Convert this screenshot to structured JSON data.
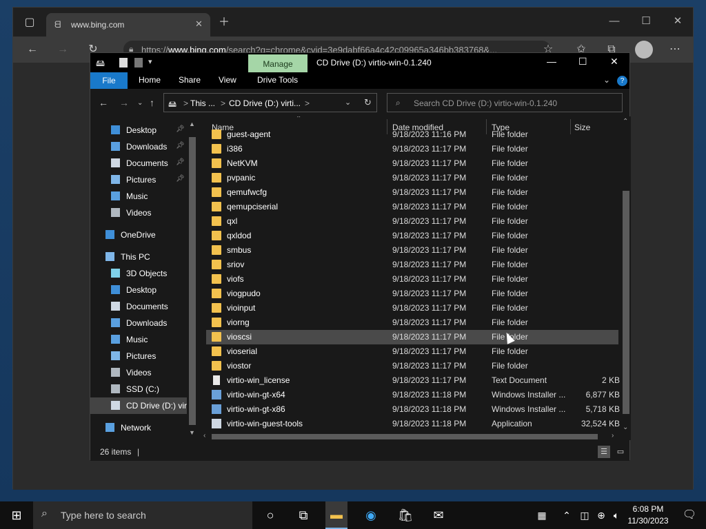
{
  "browser": {
    "tab_title": "www.bing.com",
    "url_prefix": "https://",
    "url_host": "www.bing.com",
    "url_rest": "/search?q=chrome&cvid=3e9dabf66a4c42c09965a346bb383768&..."
  },
  "explorer": {
    "context_tab": "Manage",
    "title": "CD Drive (D:) virtio-win-0.1.240",
    "ribbon": {
      "file": "File",
      "home": "Home",
      "share": "Share",
      "view": "View",
      "drive_tools": "Drive Tools"
    },
    "address": {
      "seg1": "This ...",
      "seg2": "CD Drive (D:) virti...",
      "sep": ">"
    },
    "search_placeholder": "Search CD Drive (D:) virtio-win-0.1.240",
    "columns": {
      "name": "Name",
      "date": "Date modified",
      "type": "Type",
      "size": "Size"
    },
    "sidebar": [
      {
        "label": "Desktop",
        "pinned": true,
        "icon": "desktop-icon"
      },
      {
        "label": "Downloads",
        "pinned": true,
        "icon": "downloads-icon"
      },
      {
        "label": "Documents",
        "pinned": true,
        "icon": "documents-icon"
      },
      {
        "label": "Pictures",
        "pinned": true,
        "icon": "pictures-icon"
      },
      {
        "label": "Music",
        "pinned": false,
        "icon": "music-icon"
      },
      {
        "label": "Videos",
        "pinned": false,
        "icon": "videos-icon"
      },
      {
        "label": "OneDrive",
        "pinned": false,
        "icon": "onedrive-icon"
      },
      {
        "label": "This PC",
        "pinned": false,
        "icon": "this-pc-icon"
      },
      {
        "label": "3D Objects",
        "pinned": false,
        "icon": "3d-objects-icon"
      },
      {
        "label": "Desktop",
        "pinned": false,
        "icon": "desktop-icon"
      },
      {
        "label": "Documents",
        "pinned": false,
        "icon": "documents-icon"
      },
      {
        "label": "Downloads",
        "pinned": false,
        "icon": "downloads-icon"
      },
      {
        "label": "Music",
        "pinned": false,
        "icon": "music-icon"
      },
      {
        "label": "Pictures",
        "pinned": false,
        "icon": "pictures-icon"
      },
      {
        "label": "Videos",
        "pinned": false,
        "icon": "videos-icon"
      },
      {
        "label": "SSD (C:)",
        "pinned": false,
        "icon": "drive-icon"
      },
      {
        "label": "CD Drive (D:) virt",
        "pinned": false,
        "icon": "cd-drive-icon"
      },
      {
        "label": "Network",
        "pinned": false,
        "icon": "network-icon"
      }
    ],
    "files": [
      {
        "name": "guest-agent",
        "date": "9/18/2023 11:16 PM",
        "type": "File folder",
        "size": "",
        "kind": "folder"
      },
      {
        "name": "i386",
        "date": "9/18/2023 11:17 PM",
        "type": "File folder",
        "size": "",
        "kind": "folder"
      },
      {
        "name": "NetKVM",
        "date": "9/18/2023 11:17 PM",
        "type": "File folder",
        "size": "",
        "kind": "folder"
      },
      {
        "name": "pvpanic",
        "date": "9/18/2023 11:17 PM",
        "type": "File folder",
        "size": "",
        "kind": "folder"
      },
      {
        "name": "qemufwcfg",
        "date": "9/18/2023 11:17 PM",
        "type": "File folder",
        "size": "",
        "kind": "folder"
      },
      {
        "name": "qemupciserial",
        "date": "9/18/2023 11:17 PM",
        "type": "File folder",
        "size": "",
        "kind": "folder"
      },
      {
        "name": "qxl",
        "date": "9/18/2023 11:17 PM",
        "type": "File folder",
        "size": "",
        "kind": "folder"
      },
      {
        "name": "qxldod",
        "date": "9/18/2023 11:17 PM",
        "type": "File folder",
        "size": "",
        "kind": "folder"
      },
      {
        "name": "smbus",
        "date": "9/18/2023 11:17 PM",
        "type": "File folder",
        "size": "",
        "kind": "folder"
      },
      {
        "name": "sriov",
        "date": "9/18/2023 11:17 PM",
        "type": "File folder",
        "size": "",
        "kind": "folder"
      },
      {
        "name": "viofs",
        "date": "9/18/2023 11:17 PM",
        "type": "File folder",
        "size": "",
        "kind": "folder"
      },
      {
        "name": "viogpudo",
        "date": "9/18/2023 11:17 PM",
        "type": "File folder",
        "size": "",
        "kind": "folder"
      },
      {
        "name": "vioinput",
        "date": "9/18/2023 11:17 PM",
        "type": "File folder",
        "size": "",
        "kind": "folder"
      },
      {
        "name": "viorng",
        "date": "9/18/2023 11:17 PM",
        "type": "File folder",
        "size": "",
        "kind": "folder"
      },
      {
        "name": "vioscsi",
        "date": "9/18/2023 11:17 PM",
        "type": "File folder",
        "size": "",
        "kind": "folder",
        "hover": true
      },
      {
        "name": "vioserial",
        "date": "9/18/2023 11:17 PM",
        "type": "File folder",
        "size": "",
        "kind": "folder"
      },
      {
        "name": "viostor",
        "date": "9/18/2023 11:17 PM",
        "type": "File folder",
        "size": "",
        "kind": "folder"
      },
      {
        "name": "virtio-win_license",
        "date": "9/18/2023 11:17 PM",
        "type": "Text Document",
        "size": "2 KB",
        "kind": "doc"
      },
      {
        "name": "virtio-win-gt-x64",
        "date": "9/18/2023 11:18 PM",
        "type": "Windows Installer ...",
        "size": "6,877 KB",
        "kind": "msi"
      },
      {
        "name": "virtio-win-gt-x86",
        "date": "9/18/2023 11:18 PM",
        "type": "Windows Installer ...",
        "size": "5,718 KB",
        "kind": "msi"
      },
      {
        "name": "virtio-win-guest-tools",
        "date": "9/18/2023 11:18 PM",
        "type": "Application",
        "size": "32,524 KB",
        "kind": "app"
      }
    ],
    "status": "26 items"
  },
  "taskbar": {
    "search_placeholder": "Type here to search",
    "time": "6:08 PM",
    "date": "11/30/2023"
  }
}
